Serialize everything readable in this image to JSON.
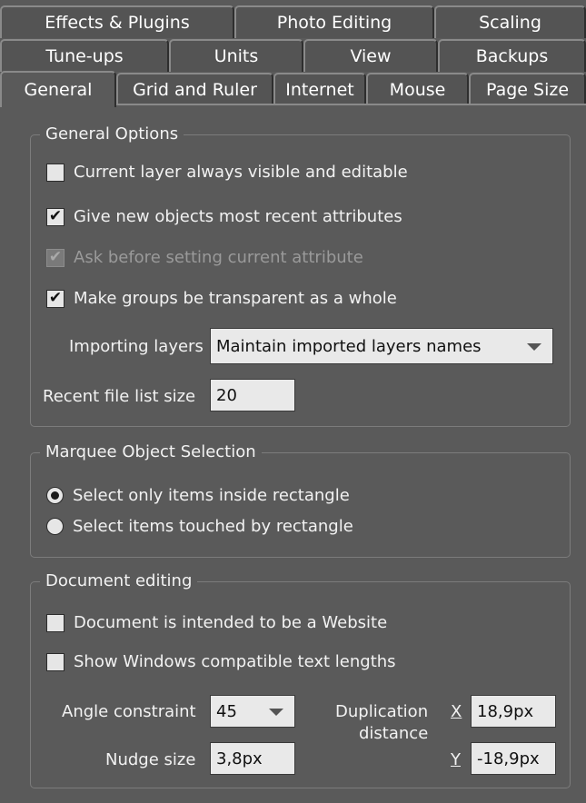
{
  "tabs_row1": [
    {
      "label": "Effects & Plugins"
    },
    {
      "label": "Photo Editing"
    },
    {
      "label": "Scaling"
    }
  ],
  "tabs_row2": [
    {
      "label": "Tune-ups"
    },
    {
      "label": "Units"
    },
    {
      "label": "View"
    },
    {
      "label": "Backups"
    }
  ],
  "tabs_row3": [
    {
      "label": "General",
      "active": true
    },
    {
      "label": "Grid and Ruler"
    },
    {
      "label": "Internet"
    },
    {
      "label": "Mouse"
    },
    {
      "label": "Page Size"
    }
  ],
  "general_options": {
    "legend": "General Options",
    "current_layer": {
      "label": "Current layer always visible and editable",
      "checked": false
    },
    "recent_attributes": {
      "label": "Give new objects most recent attributes",
      "checked": true
    },
    "ask_before": {
      "label": "Ask before setting current attribute",
      "checked": true,
      "disabled": true
    },
    "groups_transparent": {
      "label": "Make groups be transparent as a whole",
      "checked": true
    },
    "importing_layers_label": "Importing layers",
    "importing_layers_value": "Maintain imported layers names",
    "recent_file_label": "Recent file list size",
    "recent_file_value": "20"
  },
  "marquee": {
    "legend": "Marquee Object Selection",
    "option_inside": {
      "label": "Select only items inside rectangle",
      "selected": true
    },
    "option_touched": {
      "label": "Select items touched by rectangle",
      "selected": false
    }
  },
  "document_editing": {
    "legend": "Document editing",
    "website": {
      "label": "Document is intended to be a Website",
      "checked": false
    },
    "windows_text": {
      "label": "Show Windows compatible text lengths",
      "checked": false
    },
    "angle_label": "Angle constraint",
    "angle_value": "45",
    "nudge_label": "Nudge size",
    "nudge_value": "3,8px",
    "dup_label_1": "Duplication",
    "dup_label_2": "distance",
    "x_label": "X",
    "x_value": "18,9px",
    "y_label": "Y",
    "y_value": "-18,9px"
  },
  "icons": {
    "checkmark": "checkmark-icon",
    "dropdown": "chevron-down-icon"
  }
}
